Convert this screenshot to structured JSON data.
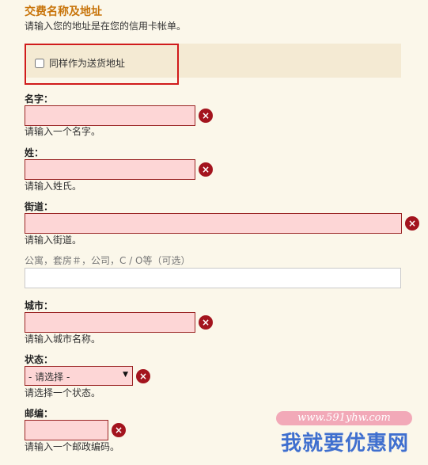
{
  "section": {
    "title": "交费名称及地址",
    "subtitle": "请输入您的地址是在您的信用卡帐单。"
  },
  "shipping": {
    "checkbox_label": "同样作为送货地址",
    "checked": false
  },
  "fields": {
    "first_name": {
      "label": "名字：",
      "hint": "请输入一个名字。",
      "value": ""
    },
    "last_name": {
      "label": "姓：",
      "hint": "请输入姓氏。",
      "value": ""
    },
    "street": {
      "label": "街道：",
      "hint": "请输入街道。",
      "value": ""
    },
    "street2": {
      "label": "公寓，套房＃，公司，C / O等（可选）",
      "value": ""
    },
    "city": {
      "label": "城市：",
      "hint": "请输入城市名称。",
      "value": ""
    },
    "state": {
      "label": "状态：",
      "hint": "请选择一个状态。",
      "selected": "- 请选择 -"
    },
    "zip": {
      "label": "邮编：",
      "hint": "请输入一个邮政编码。",
      "value": ""
    }
  },
  "icons": {
    "error": "error-x-icon",
    "dropdown": "dropdown-arrow-icon",
    "error_glyph": "×"
  },
  "watermark": {
    "url": "www.591yhw.com",
    "name": "我就要优惠网"
  },
  "colors": {
    "title": "#c8740a",
    "field_error_bg": "#fdd6d6",
    "field_error_border": "#9a2525",
    "error_icon": "#a3141e",
    "highlight_frame": "#d01b1b"
  }
}
